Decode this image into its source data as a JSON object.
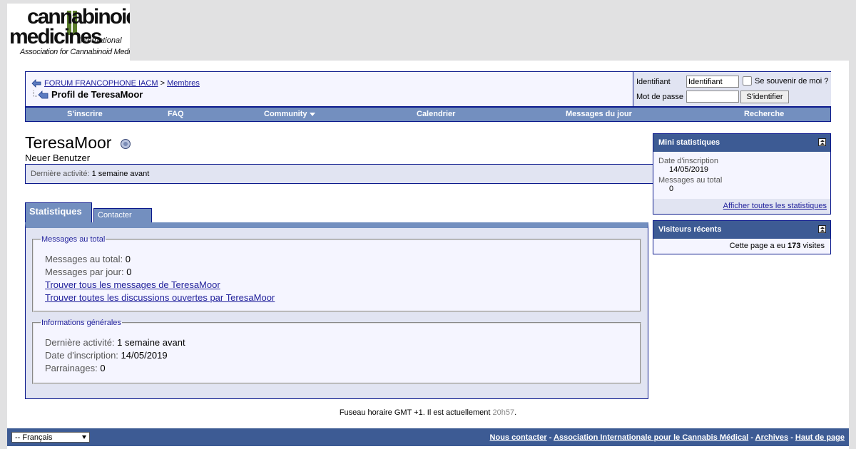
{
  "logo": {
    "line1": "cannabinoid",
    "line2": "medicines",
    "line3": "International",
    "line4": "Association for Cannabinoid Medicines"
  },
  "breadcrumb": {
    "forum": "FORUM FRANCOPHONE IACM",
    "sep": ">",
    "members": "Membres",
    "current": "Profil de TeresaMoor"
  },
  "login": {
    "username_label": "Identifiant",
    "username_value": "Identifiant",
    "password_label": "Mot de passe",
    "remember_label": "Se souvenir de moi ?",
    "submit_label": "S'identifier"
  },
  "menu": {
    "register": "S'inscrire",
    "faq": "FAQ",
    "community": "Community",
    "calendar": "Calendrier",
    "todays_posts": "Messages du jour",
    "search": "Recherche"
  },
  "profile": {
    "username": "TeresaMoor",
    "usertitle": "Neuer Benutzer",
    "last_activity_label": "Dernière activité:",
    "last_activity_value": "1 semaine avant"
  },
  "tabs": {
    "stats": "Statistiques",
    "contact": "Contacter"
  },
  "stats": {
    "posts_legend": "Messages au total",
    "total_posts_label": "Messages au total:",
    "total_posts_value": "0",
    "posts_per_day_label": "Messages par jour:",
    "posts_per_day_value": "0",
    "find_posts_link": "Trouver tous les messages de TeresaMoor",
    "find_threads_link": "Trouver toutes les discussions ouvertes par TeresaMoor",
    "general_legend": "Informations générales",
    "last_activity_label": "Dernière activité:",
    "last_activity_value": "1 semaine avant",
    "join_date_label": "Date d'inscription:",
    "join_date_value": "14/05/2019",
    "referrals_label": "Parrainages:",
    "referrals_value": "0"
  },
  "mini_stats": {
    "title": "Mini statistiques",
    "join_date_label": "Date d'inscription",
    "join_date_value": "14/05/2019",
    "total_posts_label": "Messages au total",
    "total_posts_value": "0",
    "show_all_link": "Afficher toutes les statistiques"
  },
  "visitors": {
    "title": "Visiteurs récents",
    "prefix": "Cette page a eu",
    "count": "173",
    "suffix": "visites"
  },
  "footer": {
    "tz_text": "Fuseau horaire GMT +1. Il est actuellement",
    "time": "20h57",
    "period": ".",
    "language": "-- Français",
    "links": {
      "contact": "Nous contacter",
      "association": "Association Internationale pour le Cannabis Médical",
      "archives": "Archives",
      "top": "Haut de page"
    },
    "link_sep": "-"
  },
  "colors": {
    "border": "#0b198c",
    "header_bg": "#3d5b94",
    "menu_bg": "#738fbf",
    "panel_bg": "#e1e4f2",
    "link": "#22229c"
  }
}
